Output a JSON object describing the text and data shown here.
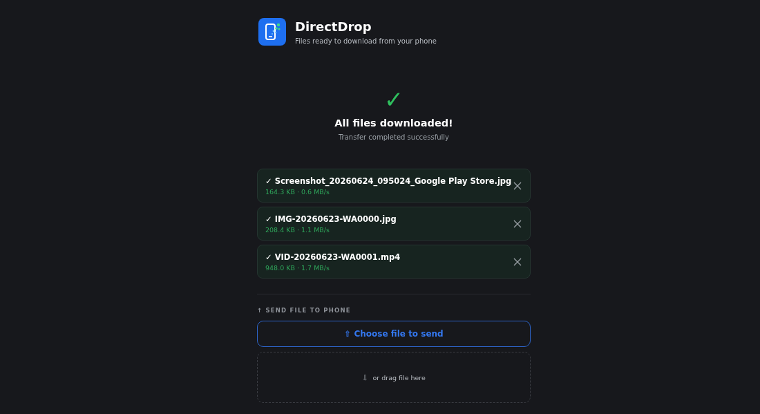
{
  "app": {
    "title": "DirectDrop",
    "subtitle": "Files ready to download from your phone"
  },
  "status": {
    "mark": "✓",
    "title": "All files downloaded!",
    "subtitle": "Transfer completed successfully"
  },
  "files": [
    {
      "name": "✓ Screenshot_20260624_095024_Google Play Store.jpg",
      "meta": "164.3 KB · 0.6 MB/s"
    },
    {
      "name": "✓ IMG-20260623-WA0000.jpg",
      "meta": "208.4 KB · 1.1 MB/s"
    },
    {
      "name": "✓ VID-20260623-WA0001.mp4",
      "meta": "948.0 KB · 1.7 MB/s"
    }
  ],
  "send": {
    "heading": "↑ SEND FILE TO PHONE",
    "button": "⇧ Choose file to send",
    "drop_icon": "⇩",
    "drop_text": "or drag file here"
  }
}
